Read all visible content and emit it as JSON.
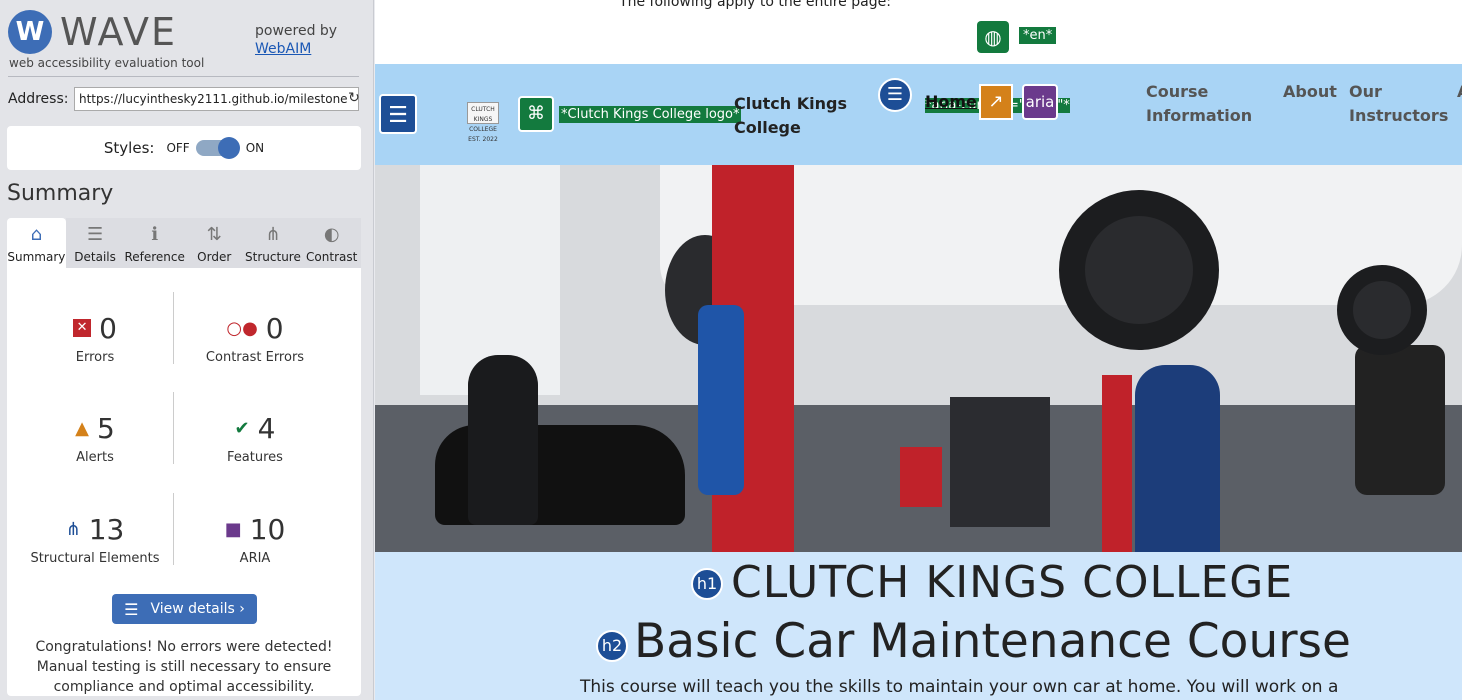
{
  "wave": {
    "logo_letter": "W",
    "logo_text": "WAVE",
    "tagline": "web accessibility evaluation tool",
    "powered_by": "powered by",
    "webaim_link": "WebAIM",
    "address_label": "Address:",
    "address_value": "https://lucyinthesky2111.github.io/milestone",
    "styles_label": "Styles:",
    "styles_off": "OFF",
    "styles_on": "ON",
    "summary_heading": "Summary",
    "tabs": [
      {
        "label": "Summary",
        "icon": "⌂"
      },
      {
        "label": "Details",
        "icon": "☰"
      },
      {
        "label": "Reference",
        "icon": "ℹ"
      },
      {
        "label": "Order",
        "icon": "⇅"
      },
      {
        "label": "Structure",
        "icon": "⋔"
      },
      {
        "label": "Contrast",
        "icon": "◐"
      }
    ],
    "stats": {
      "errors": {
        "value": "0",
        "label": "Errors",
        "color": "#c0272d"
      },
      "contrast_errors": {
        "value": "0",
        "label": "Contrast Errors",
        "color": "#c0272d"
      },
      "alerts": {
        "value": "5",
        "label": "Alerts",
        "color": "#d4811a"
      },
      "features": {
        "value": "4",
        "label": "Features",
        "color": "#137a3e"
      },
      "structural": {
        "value": "13",
        "label": "Structural Elements",
        "color": "#1d4e96"
      },
      "aria": {
        "value": "10",
        "label": "ARIA",
        "color": "#6b3a8c"
      }
    },
    "view_details": "View details ›",
    "congrats": "Congratulations! No errors were detected! Manual testing is still necessary to ensure compliance and optimal accessibility."
  },
  "preview": {
    "page_note": "The following apply to the entire page:",
    "lang_badge": "*en*",
    "alt_badge": "*Clutch Kings College logo*",
    "logo_text": "CLUTCH KINGS COLLEGE EST. 2022",
    "site_name": "Clutch Kings College",
    "nav": {
      "home": "Home",
      "aria_badge": "*aria-current=\"page\"*",
      "aria_icon": "aria",
      "course": "Course Information",
      "about": "About",
      "instructors": "Our Instructors",
      "overflow": "A"
    },
    "h1_icon": "h1",
    "h2_icon": "h2",
    "h1": "CLUTCH KINGS COLLEGE",
    "h2": "Basic Car Maintenance Course",
    "intro": "This course will teach you the skills to maintain your own car at home. You will work on a"
  }
}
